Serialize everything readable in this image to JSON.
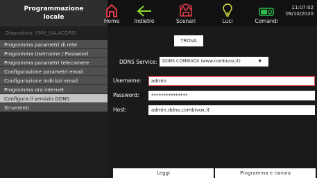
{
  "header": {
    "title_line1": "Programmazione",
    "title_line2": "locale",
    "nav": [
      {
        "label": "Home",
        "icon": "home-icon"
      },
      {
        "label": "Indietro",
        "icon": "back-arrow-icon"
      },
      {
        "label": "Scenari",
        "icon": "scenes-icon"
      },
      {
        "label": "Luci",
        "icon": "bulb-icon"
      },
      {
        "label": "Comandi",
        "icon": "toggle-icon"
      }
    ],
    "time": "11:07:02",
    "date": "09/10/2020",
    "accent_color": "#e23b4a",
    "back_color": "#8edb2f",
    "bulb_color": "#d8e040",
    "toggle_color": "#2ebd4e"
  },
  "sidebar": {
    "device": "Dispositivo: SMV_SALACORSI",
    "items": [
      {
        "label": "Programma parametri di rete"
      },
      {
        "label": "Programma Username / Password"
      },
      {
        "label": "Programma parametri telecamere"
      },
      {
        "label": "Configurazione parametri email"
      },
      {
        "label": "Configurazione indirizzi email"
      },
      {
        "label": "Programma ora internet"
      },
      {
        "label": "Configura il servizio DDNS"
      },
      {
        "label": "Strumenti"
      }
    ]
  },
  "form": {
    "trova_label": "TROVA",
    "service_label": "DDNS Service:",
    "service_value": "DDNS COMBIVOX (www.combivox.it)",
    "username_label": "Username:",
    "username_value": "admin",
    "password_label": "Password:",
    "password_value": "***************",
    "host_label": "Host:",
    "host_value": "admin.ddns.combivox.it"
  },
  "footer": {
    "read_label": "Leggi",
    "program_label": "Programma e riavvia"
  }
}
